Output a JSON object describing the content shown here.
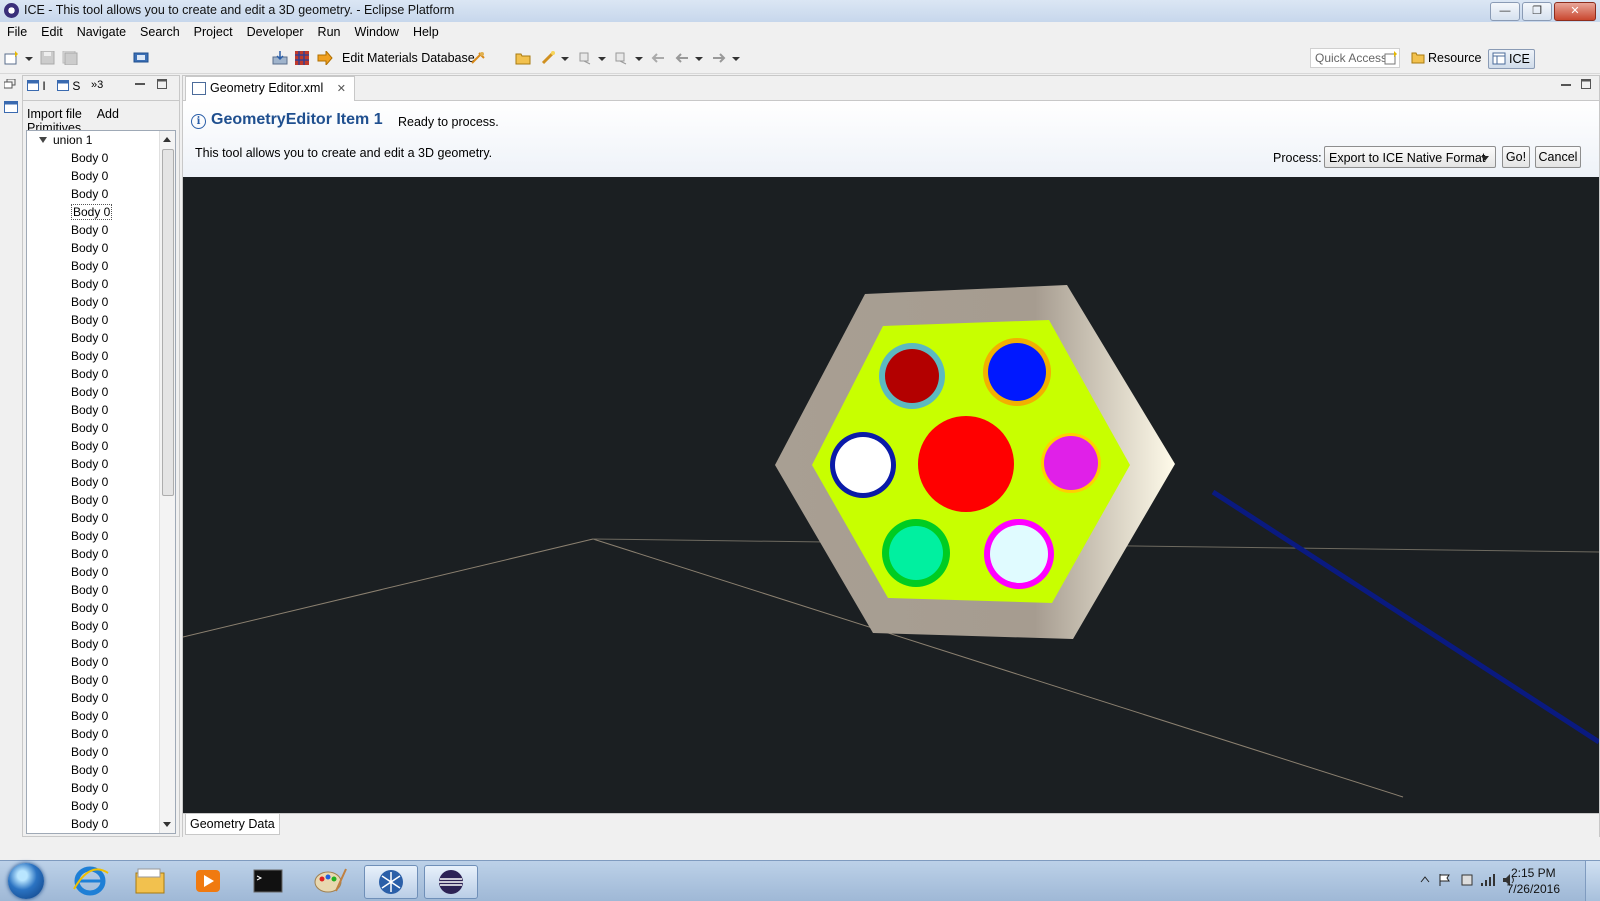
{
  "window": {
    "title": "ICE - This tool allows you to create and edit a 3D geometry. - Eclipse Platform",
    "controls": [
      "—",
      "❐",
      "✕"
    ]
  },
  "menu": [
    "File",
    "Edit",
    "Navigate",
    "Search",
    "Project",
    "Developer",
    "Run",
    "Window",
    "Help"
  ],
  "toolbar": {
    "edit_materials_label": "Edit Materials Database",
    "quick_access_placeholder": "Quick Access",
    "perspective_resource": "Resource",
    "perspective_ice": "ICE"
  },
  "left_panel": {
    "tab1_label": "I",
    "tab2_label": "S",
    "overflow_label": "»3",
    "actions": [
      "Import file",
      "Add Primitives"
    ],
    "tree": {
      "root_label": "union 1",
      "children": [
        "Body 0",
        "Body 0",
        "Body 0",
        "Body 0",
        "Body 0",
        "Body 0",
        "Body 0",
        "Body 0",
        "Body 0",
        "Body 0",
        "Body 0",
        "Body 0",
        "Body 0",
        "Body 0",
        "Body 0",
        "Body 0",
        "Body 0",
        "Body 0",
        "Body 0",
        "Body 0",
        "Body 0",
        "Body 0",
        "Body 0",
        "Body 0",
        "Body 0",
        "Body 0",
        "Body 0",
        "Body 0",
        "Body 0",
        "Body 0",
        "Body 0",
        "Body 0",
        "Body 0",
        "Body 0",
        "Body 0",
        "Body 0",
        "Body 0",
        "Body 0",
        "Body 0"
      ],
      "selected_index": 3
    }
  },
  "editor": {
    "tab_label": "Geometry Editor.xml",
    "form_title": "GeometryEditor Item 1",
    "status": "Ready to process.",
    "description": "This tool allows you to create and edit a 3D geometry.",
    "process_label": "Process:",
    "process_value": "Export to ICE Native Format",
    "go_label": "Go!",
    "cancel_label": "Cancel",
    "bottom_tab": "Geometry Data"
  },
  "taskbar": {
    "time": "2:15 PM",
    "date": "7/26/2016"
  },
  "colors": {
    "viewport_bg": "#1b1f22",
    "hex_outer": "#a89f93",
    "hex_inner": "#c8ff00",
    "form_title": "#1f4f8f"
  }
}
